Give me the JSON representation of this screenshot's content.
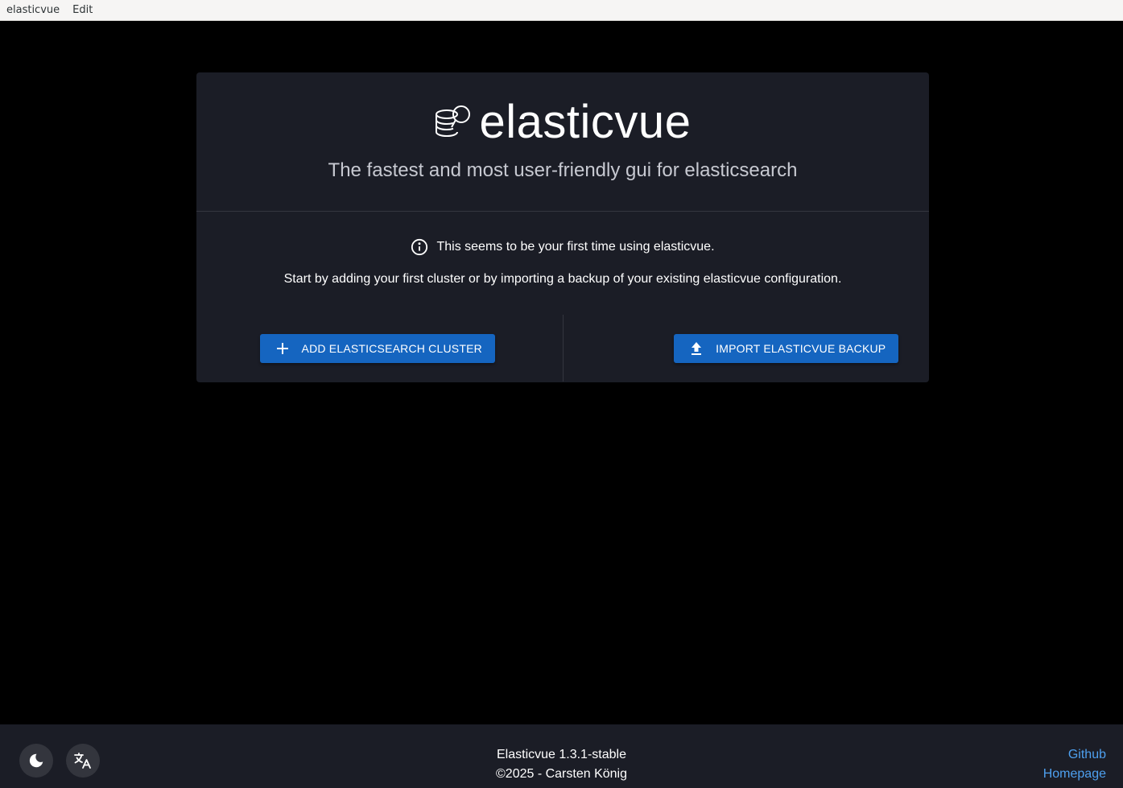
{
  "menubar": {
    "items": [
      "elasticvue",
      "Edit"
    ]
  },
  "card": {
    "brand": "elasticvue",
    "tagline": "The fastest and most user-friendly gui for elasticsearch",
    "info_text": "This seems to be your first time using elasticvue.",
    "start_text": "Start by adding your first cluster or by importing a backup of your existing elasticvue configuration.",
    "add_button_label": "ADD ELASTICSEARCH CLUSTER",
    "import_button_label": "IMPORT ELASTICVUE BACKUP"
  },
  "footer": {
    "version": "Elasticvue 1.3.1-stable",
    "copyright": "©2025 - Carsten König",
    "links": [
      "Github",
      "Homepage"
    ],
    "theme_button_icon": "moon-icon",
    "language_button_icon": "translate-icon"
  },
  "colors": {
    "background": "#000000",
    "card": "#1b1d26",
    "primary_button": "#1565c0",
    "link": "#4ea0ef"
  }
}
